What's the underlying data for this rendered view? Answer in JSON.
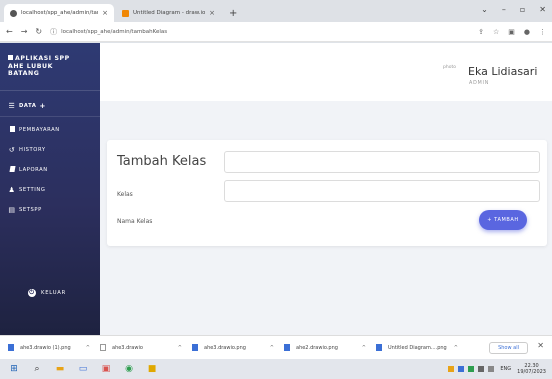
{
  "browser": {
    "tabs": [
      {
        "label": "localhost/spp_ahe/admin/tamb",
        "active": true
      },
      {
        "label": "Untitled Diagram - draw.io",
        "active": false
      }
    ],
    "new_tab": "+",
    "url": "localhost/spp_ahe/admin/tambahKelas"
  },
  "sidebar": {
    "brand": [
      "APLIKASI SPP",
      "AHE LUBUK",
      "BATANG"
    ],
    "section": "DATA",
    "items": [
      {
        "label": "PEMBAYARAN",
        "icon": "file-icon"
      },
      {
        "label": "HISTORY",
        "icon": "history-icon"
      },
      {
        "label": "LAPORAN",
        "icon": "book-icon"
      },
      {
        "label": "SETTING",
        "icon": "users-icon"
      },
      {
        "label": "SETSPP",
        "icon": "list-icon"
      }
    ],
    "logout": "KELUAR"
  },
  "header": {
    "avatar_alt": "photo",
    "user_name": "Eka Lidiasari",
    "user_role": "ADMIN"
  },
  "form": {
    "title": "Tambah Kelas",
    "fields": [
      {
        "label": "Kelas",
        "value": ""
      },
      {
        "label": "Nama Kelas",
        "value": ""
      }
    ],
    "submit": "+ TAMBAH"
  },
  "downloads": {
    "items": [
      "ahe3.drawio (1).png",
      "ahe3.drawio",
      "ahe3.drawio.png",
      "ahe2.drawio.png",
      "Untitled Diagram....png"
    ],
    "show_all": "Show all"
  },
  "taskbar": {
    "lang": "ENG",
    "time": "22.30",
    "date": "19/07/2023"
  },
  "colors": {
    "sidebar": "#2e3a73",
    "accent": "#5a66e0"
  }
}
